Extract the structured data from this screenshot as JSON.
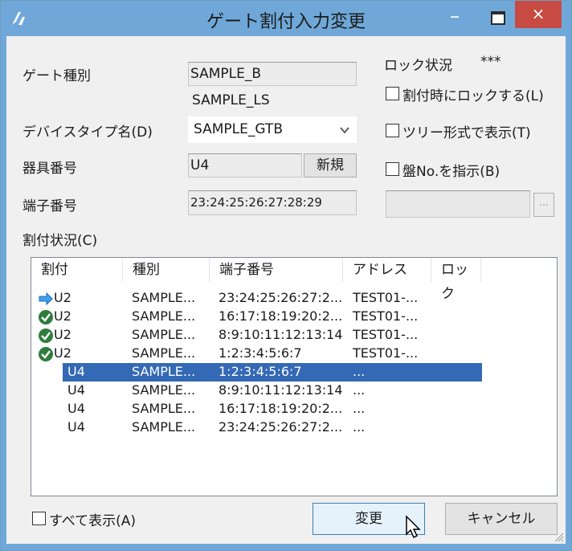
{
  "window": {
    "title": "ゲート割付入力変更",
    "minimize_glyph": "–",
    "close_glyph": "×"
  },
  "gate_type": {
    "label": "ゲート種別",
    "value": "SAMPLE_B",
    "subvalue": "SAMPLE_LS"
  },
  "device_type": {
    "label": "デバイスタイプ名(D)",
    "value": "SAMPLE_GTB"
  },
  "fixture": {
    "label": "器具番号",
    "value": "U4",
    "new_button": "新規"
  },
  "terminal": {
    "label": "端子番号",
    "value": "23:24:25:26:27:28:29"
  },
  "lock": {
    "label": "ロック状況",
    "value": "***",
    "checkbox_label": "割付時にロックする(L)"
  },
  "tree_checkbox_label": "ツリー形式で表示(T)",
  "board_checkbox_label": "盤No.を指示(B)",
  "board_browse_label": "...",
  "assign_status": {
    "label": "割付状況(C)",
    "columns": [
      "割付",
      "種別",
      "端子番号",
      "アドレス",
      "ロック"
    ],
    "rows": [
      {
        "icon": "arrow-right-icon",
        "assign": "U2",
        "type": "SAMPLE...",
        "terminal": "23:24:25:26:27:2...",
        "address": "TEST01-...",
        "lock": ""
      },
      {
        "icon": "check-circle-icon",
        "assign": "U2",
        "type": "SAMPLE...",
        "terminal": "16:17:18:19:20:2...",
        "address": "TEST01-...",
        "lock": ""
      },
      {
        "icon": "check-circle-icon",
        "assign": "U2",
        "type": "SAMPLE...",
        "terminal": "8:9:10:11:12:13:14",
        "address": "TEST01-...",
        "lock": ""
      },
      {
        "icon": "check-circle-icon",
        "assign": "U2",
        "type": "SAMPLE...",
        "terminal": "1:2:3:4:5:6:7",
        "address": "TEST01-...",
        "lock": ""
      },
      {
        "icon": "",
        "assign": "U4",
        "type": "SAMPLE...",
        "terminal": "1:2:3:4:5:6:7",
        "address": "...",
        "lock": "",
        "selected": true
      },
      {
        "icon": "",
        "assign": "U4",
        "type": "SAMPLE...",
        "terminal": "8:9:10:11:12:13:14",
        "address": "...",
        "lock": ""
      },
      {
        "icon": "",
        "assign": "U4",
        "type": "SAMPLE...",
        "terminal": "16:17:18:19:20:2...",
        "address": "...",
        "lock": ""
      },
      {
        "icon": "",
        "assign": "U4",
        "type": "SAMPLE...",
        "terminal": "23:24:25:26:27:2...",
        "address": "...",
        "lock": ""
      }
    ]
  },
  "show_all_label": "すべて表示(A)",
  "buttons": {
    "change": "変更",
    "cancel": "キャンセル"
  },
  "colors": {
    "titlebar": "#6fa8d8",
    "close": "#c74b43",
    "selection": "#3469b5",
    "check": "#2f7d3c",
    "arrow": "#2a8fe0"
  }
}
